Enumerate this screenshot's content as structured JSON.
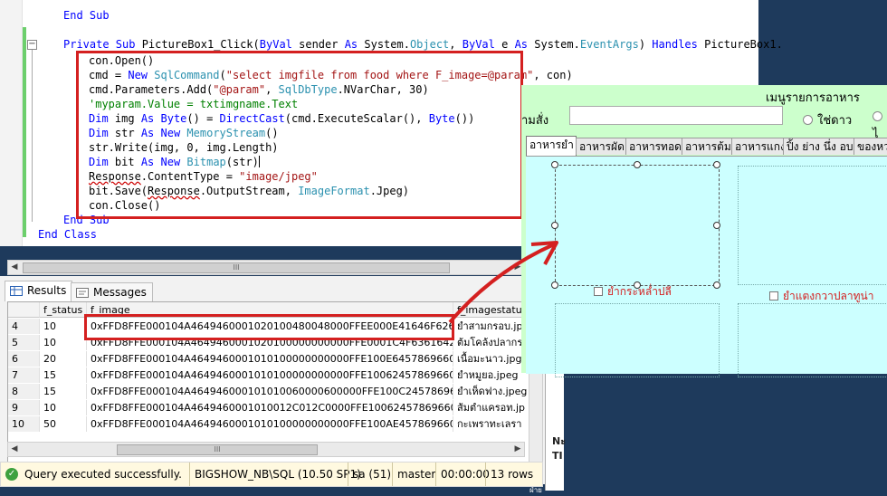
{
  "code": {
    "line_end_sub_top": "End Sub",
    "line_signature": {
      "kw1": "Private Sub",
      "name": " PictureBox1_Click(",
      "kw2": "ByVal",
      "p1": " sender ",
      "kw3": "As",
      "p2": " System.",
      "t1": "Object",
      "p3": ", ",
      "kw4": "ByVal",
      "p4": " e ",
      "kw5": "As",
      "p5": " System.",
      "t2": "EventArgs",
      "p6": ") ",
      "kw6": "Handles",
      "p7": " PictureBox1."
    },
    "line_open": "con.Open()",
    "line_cmd": {
      "a": "cmd = ",
      "kw": "New",
      "sp": " ",
      "t": "SqlCommand",
      "b": "(",
      "s": "\"select imgfile from food where F_image=@param\"",
      "c": ", con)"
    },
    "line_params": {
      "a": "cmd.Parameters.Add(",
      "s": "\"@param\"",
      "b": ", ",
      "t": "SqlDbType",
      "c": ".NVarChar, 30)"
    },
    "line_comment": "'myparam.Value = txtimgname.Text",
    "line_img": {
      "kw1": "Dim",
      "a": " img ",
      "kw2": "As",
      "b": " ",
      "kw3": "Byte",
      "c": "() = ",
      "kw4": "DirectCast",
      "d": "(cmd.ExecuteScalar(), ",
      "kw5": "Byte",
      "e": "())"
    },
    "line_str": {
      "kw1": "Dim",
      "a": " str ",
      "kw2": "As",
      "b": " ",
      "kw3": "New",
      "c": " ",
      "t": "MemoryStream",
      "d": "()"
    },
    "line_write": "str.Write(img, 0, img.Length)",
    "line_bit": {
      "kw1": "Dim",
      "a": " bit ",
      "kw2": "As",
      "b": " ",
      "kw3": "New",
      "c": " ",
      "t": "Bitmap",
      "d": "(str)"
    },
    "line_ctype": {
      "a": "Response",
      "b": ".ContentType = ",
      "s": "\"image/jpeg\""
    },
    "line_save": {
      "a": "bit.Save(",
      "b": "Response",
      "c": ".OutputStream, ",
      "t": "ImageFormat",
      "d": ".Jpeg)"
    },
    "line_close": "con.Close()",
    "line_end_sub": "End Sub",
    "line_end_class": "End Class"
  },
  "scrollbar_grip": "III",
  "results": {
    "tabs": [
      "Results",
      "Messages"
    ],
    "columns": [
      "f_status",
      "f_image",
      "f_imagestatus"
    ],
    "rows": [
      {
        "num": "4",
        "status": "10",
        "image": "0xFFD8FFE000104A4649460001020100480048000FFEE000E41646F626500...",
        "istatus": "ยำสามกรอบ.jp"
      },
      {
        "num": "5",
        "status": "10",
        "image": "0xFFD8FFE000104A4649460001020100000000000FFE0001C4F63616424526...",
        "istatus": "ต้มโคล้งปลากร"
      },
      {
        "num": "6",
        "status": "20",
        "image": "0xFFD8FFE000104A4649460001010100000000000FFE100E645786966000004...",
        "istatus": "เนื้อมะนาว.jpg"
      },
      {
        "num": "7",
        "status": "15",
        "image": "0xFFD8FFE000104A4649460001010100000000000FFE100624578696600004...",
        "istatus": "ยำหมูยอ.jpeg"
      },
      {
        "num": "8",
        "status": "15",
        "image": "0xFFD8FFE000104A464946000101010060000600000FFE100C2457869660000...",
        "istatus": "ยำเห็ดฟาง.jpeg"
      },
      {
        "num": "9",
        "status": "10",
        "image": "0xFFD8FFE000104A4649460001010012C012C0000FFE100624578696600004...",
        "istatus": "ส้มตำแครอท.jp"
      },
      {
        "num": "10",
        "status": "50",
        "image": "0xFFD8FFE000104A4649460001010100000000000FFE100AE457869660000...",
        "istatus": "กะเพราทะเลรา"
      }
    ]
  },
  "status_bar": {
    "message": "Query executed successfully.",
    "server": "BIGSHOW_NB\\SQL (10.50 SP1)",
    "user": "sa (51)",
    "database": "master",
    "elapsed": "00:00:00",
    "row_count": "13 rows"
  },
  "side_panel_label": "Nะ\nTI",
  "designer": {
    "title": "เมนูรายการอาหาร",
    "order_label": "ามสั่ง",
    "radio_options": [
      "ใช่ดาว",
      "ไ"
    ],
    "tabs": [
      "อาหารยำ",
      "อาหารผัด",
      "อาหารทอด",
      "อาหารต้ม",
      "อาหารแกง",
      "ปิ้ง ย่าง นึ่ง อบ",
      "ของหวาน"
    ],
    "checkbox_1": "ยำกระหล่ำปลี",
    "checkbox_2": "ยำแตงกวาปลาทูน่า"
  },
  "footer_mark": "ฝ่าย",
  "colors": {
    "highlight_box": "#d42020",
    "designer_bg": "#ccffcc",
    "tab_page_bg": "#ccffff",
    "status_ok": "#3ea13e"
  }
}
